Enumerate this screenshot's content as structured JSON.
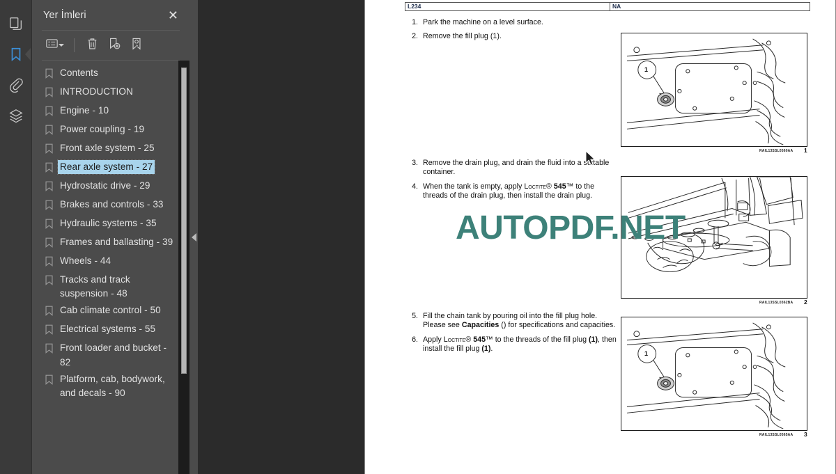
{
  "rail": {
    "items": [
      {
        "name": "thumbnails-icon",
        "title": "Sayfa Küçük Resimleri",
        "active": false
      },
      {
        "name": "bookmarks-icon",
        "title": "Yer İmleri",
        "active": true
      },
      {
        "name": "attachments-icon",
        "title": "Ekler",
        "active": false
      },
      {
        "name": "layers-icon",
        "title": "Katmanlar",
        "active": false
      }
    ]
  },
  "panel": {
    "title": "Yer İmleri",
    "close_label": "✕",
    "toolbar": {
      "options_label": "Seçenekler",
      "delete_label": "Sil",
      "new_bookmark_label": "Yeni Yer İmi",
      "edit_bookmark_label": "Yer İmini Düzenle"
    },
    "bookmarks": [
      {
        "label": "Contents",
        "selected": false
      },
      {
        "label": "INTRODUCTION",
        "selected": false
      },
      {
        "label": "Engine - 10",
        "selected": false
      },
      {
        "label": "Power coupling - 19",
        "selected": false
      },
      {
        "label": "Front axle system - 25",
        "selected": false
      },
      {
        "label": "Rear axle system - 27",
        "selected": true
      },
      {
        "label": "Hydrostatic drive - 29",
        "selected": false
      },
      {
        "label": "Brakes and controls - 33",
        "selected": false
      },
      {
        "label": "Hydraulic systems - 35",
        "selected": false
      },
      {
        "label": "Frames and ballasting - 39",
        "selected": false
      },
      {
        "label": "Wheels - 44",
        "selected": false
      },
      {
        "label": "Tracks and track suspension - 48",
        "selected": false
      },
      {
        "label": "Cab climate control - 50",
        "selected": false
      },
      {
        "label": "Electrical systems - 55",
        "selected": false
      },
      {
        "label": "Front loader and bucket - 82",
        "selected": false
      },
      {
        "label": "Platform, cab, bodywork, and decals - 90",
        "selected": false
      }
    ]
  },
  "splitter": {
    "collapse_label": "◀"
  },
  "document": {
    "header": {
      "left": "L234",
      "right": "NA"
    },
    "steps": [
      {
        "num": "1.",
        "text": "Park the machine on a level surface."
      },
      {
        "num": "2.",
        "text": "Remove the fill plug (1)."
      },
      {
        "num": "3.",
        "text": "Remove the drain plug, and drain the fluid into a suitable container."
      },
      {
        "num": "4.",
        "text": "When the tank is empty, apply LOCTITE® 545™ to the threads of the drain plug, then install the drain plug."
      },
      {
        "num": "5.",
        "text": "Fill the chain tank by pouring oil into the fill plug hole. Please see Capacities () for specifications and capacities."
      },
      {
        "num": "6.",
        "text": "Apply LOCTITE® 545™ to the threads of the fill plug (1), then install the fill plug (1)."
      }
    ],
    "step4_parts": {
      "lead": "When the tank is empty, apply ",
      "brand": "Loctite",
      "reg": "® ",
      "grade": "545",
      "tm": "™",
      "tail": " to the threads of the drain plug, then install the drain plug."
    },
    "step5_parts": {
      "lead": "Fill the chain tank by pouring oil into the fill plug hole. Please see ",
      "bold": "Capacities",
      "tail": " () for specifications and capacities."
    },
    "step6_parts": {
      "lead": "Apply ",
      "brand": "Loctite",
      "reg": "® ",
      "grade": "545",
      "tm": "™",
      "mid": " to the threads of the fill plug ",
      "ref1": "(1)",
      "mid2": ", then install the fill plug ",
      "ref2": "(1)",
      "end": "."
    },
    "figures": [
      {
        "caption": "RAIL13SSL0560AA",
        "number": "1",
        "callout": "1",
        "alt": "fill-plug-location-diagram"
      },
      {
        "caption": "RAIL13SSL0362BA",
        "number": "2",
        "callout": "",
        "alt": "drain-plug-undercarriage-diagram"
      },
      {
        "caption": "RAIL13SSL0565AA",
        "number": "3",
        "callout": "1",
        "alt": "fill-plug-install-diagram"
      }
    ]
  },
  "watermark": {
    "text": "AUTOPDF.NET",
    "color": "#3d8179"
  }
}
